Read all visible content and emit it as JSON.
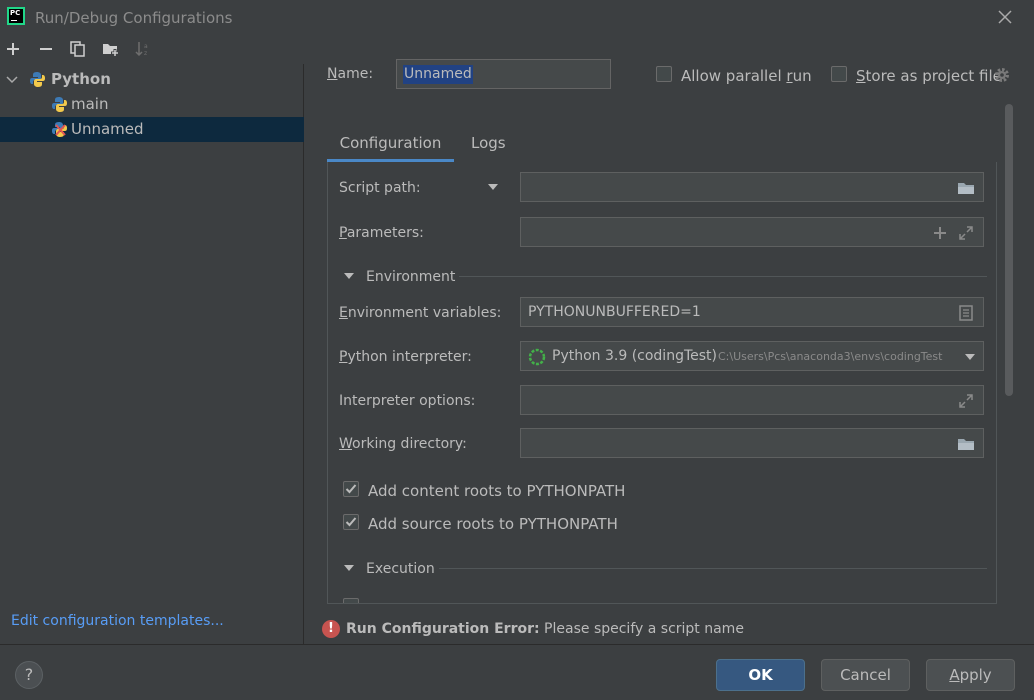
{
  "window": {
    "title": "Run/Debug Configurations",
    "app_icon_text": "PC"
  },
  "toolbar": {
    "icons": [
      "add-icon",
      "remove-icon",
      "copy-icon",
      "new-folder-icon",
      "sort-icon"
    ]
  },
  "tree": {
    "group_label": "Python",
    "items": [
      {
        "label": "main",
        "icon": "python-icon"
      },
      {
        "label": "Unnamed",
        "icon": "python-error-icon",
        "selected": true
      }
    ]
  },
  "sidebar": {
    "edit_templates": "Edit configuration templates..."
  },
  "header": {
    "name_label_first": "N",
    "name_label_rest": "ame:",
    "name_value": "Unnamed",
    "allow_parallel_first": "Allow parallel ",
    "allow_parallel_under": "r",
    "allow_parallel_rest": "un",
    "store_first": "S",
    "store_rest": "tore as project file"
  },
  "tabs": [
    {
      "label": "Configuration",
      "active": true
    },
    {
      "label": "Logs",
      "active": false
    }
  ],
  "form": {
    "script_path_label": "Script path:",
    "script_path_value": "",
    "parameters_label_first": "P",
    "parameters_label_rest": "arameters:",
    "parameters_value": "",
    "environment_section": "Environment",
    "env_vars_label_first": "E",
    "env_vars_label_rest": "nvironment variables:",
    "env_vars_value": "PYTHONUNBUFFERED=1",
    "interpreter_label_first": "P",
    "interpreter_label_rest": "ython interpreter:",
    "interpreter_name": "Python 3.9 (codingTest)",
    "interpreter_path": "C:\\Users\\Pcs\\anaconda3\\envs\\codingTest",
    "interpreter_options_label": "Interpreter options:",
    "interpreter_options_value": "",
    "working_dir_label_first": "W",
    "working_dir_label_rest": "orking directory:",
    "working_dir_value": "",
    "add_content_roots": "Add content roots to PYTHONPATH",
    "add_content_roots_checked": true,
    "add_source_roots": "Add source roots to PYTHONPATH",
    "add_source_roots_checked": true,
    "execution_section": "Execution"
  },
  "error": {
    "bold": "Run Configuration Error:",
    "message": " Please specify a script name"
  },
  "buttons": {
    "help": "?",
    "ok": "OK",
    "cancel": "Cancel",
    "apply_first": "A",
    "apply_rest": "pply"
  },
  "colors": {
    "background": "#3c3f41",
    "selection": "#0d293e",
    "accent": "#4a88c7",
    "link": "#589df6",
    "error": "#c75450",
    "ok_button": "#365880"
  }
}
